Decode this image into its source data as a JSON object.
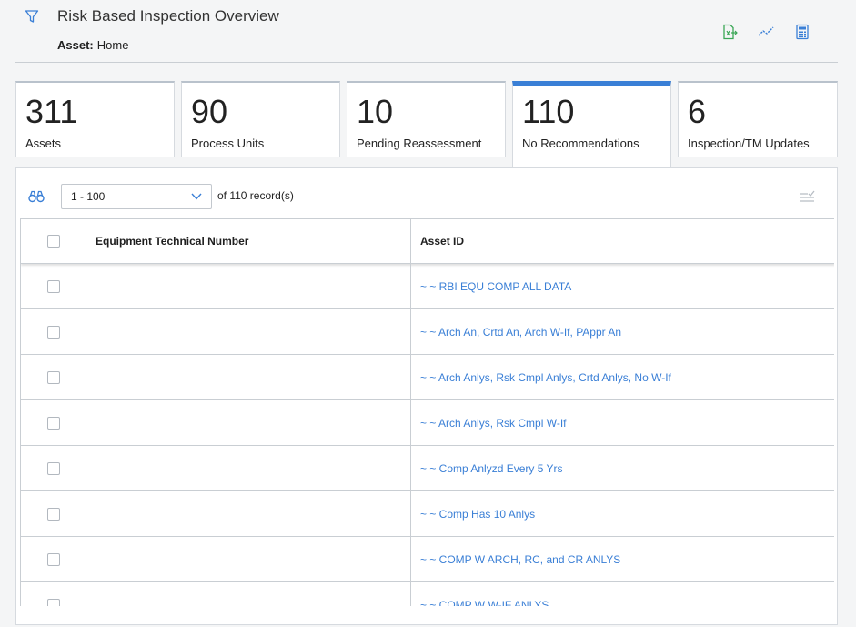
{
  "header": {
    "title": "Risk Based Inspection Overview",
    "asset_label": "Asset:",
    "asset_value": "Home",
    "icons": [
      "filter-icon",
      "export-icon",
      "trend-icon",
      "calculator-icon"
    ]
  },
  "tiles": [
    {
      "value": "311",
      "label": "Assets"
    },
    {
      "value": "90",
      "label": "Process Units"
    },
    {
      "value": "10",
      "label": "Pending Reassessment"
    },
    {
      "value": "110",
      "label": "No Recommendations"
    },
    {
      "value": "6",
      "label": "Inspection/TM Updates"
    }
  ],
  "active_tile": "No Recommendations",
  "toolbar": {
    "range_value": "1 - 100",
    "of_text": "of 110 record(s)"
  },
  "table": {
    "columns": [
      "",
      "Equipment Technical Number",
      "Asset ID"
    ],
    "rows": [
      {
        "equipment": "",
        "asset_id": "~ ~ RBI EQU COMP ALL DATA"
      },
      {
        "equipment": "",
        "asset_id": "~ ~ Arch An, Crtd An, Arch W-If, PAppr An"
      },
      {
        "equipment": "",
        "asset_id": "~ ~ Arch Anlys, Rsk Cmpl Anlys, Crtd Anlys, No W-If"
      },
      {
        "equipment": "",
        "asset_id": "~ ~ Arch Anlys, Rsk Cmpl W-If"
      },
      {
        "equipment": "",
        "asset_id": "~ ~ Comp Anlyzd Every 5 Yrs"
      },
      {
        "equipment": "",
        "asset_id": "~ ~ Comp Has 10 Anlys"
      },
      {
        "equipment": "",
        "asset_id": "~ ~ COMP W ARCH, RC, and CR ANLYS"
      },
      {
        "equipment": "",
        "asset_id": "~ ~ COMP W W-IF ANLYS"
      }
    ]
  },
  "colors": {
    "accent": "#3a7fd6",
    "icon_green": "#3aa655"
  }
}
